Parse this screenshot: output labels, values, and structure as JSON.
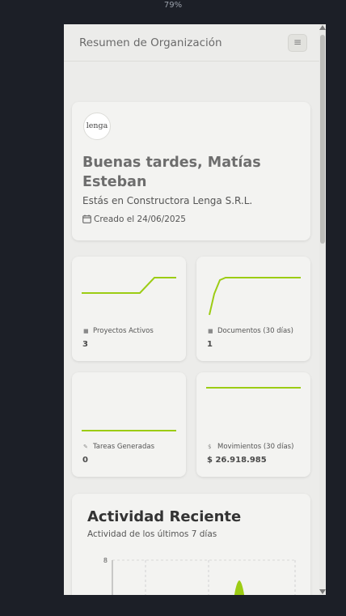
{
  "browser": {
    "zoom": "79%"
  },
  "header": {
    "title": "Resumen de Organización",
    "menu_icon": "≡"
  },
  "welcome": {
    "logo_text": "lenga",
    "greeting": "Buenas tardes, Matías Esteban",
    "org_line": "Estás en Constructora Lenga S.R.L.",
    "created": "Creado el 24/06/2025"
  },
  "stats": [
    {
      "label": "Proyectos Activos",
      "value": "3",
      "icon": "folder-icon"
    },
    {
      "label": "Documentos (30 días)",
      "value": "1",
      "icon": "document-icon"
    },
    {
      "label": "Tareas Generadas",
      "value": "0",
      "icon": "wrench-icon"
    },
    {
      "label": "Movimientos (30 días)",
      "value": "$ 26.918.985",
      "icon": "dollar-icon"
    }
  ],
  "activity": {
    "title": "Actividad Reciente",
    "subtitle": "Actividad de los últimos 7 días",
    "y_tick": "8"
  },
  "colors": {
    "accent": "#9ccc14",
    "background": "#1c1f27",
    "panel": "#ececea",
    "card": "#f3f3f1"
  }
}
